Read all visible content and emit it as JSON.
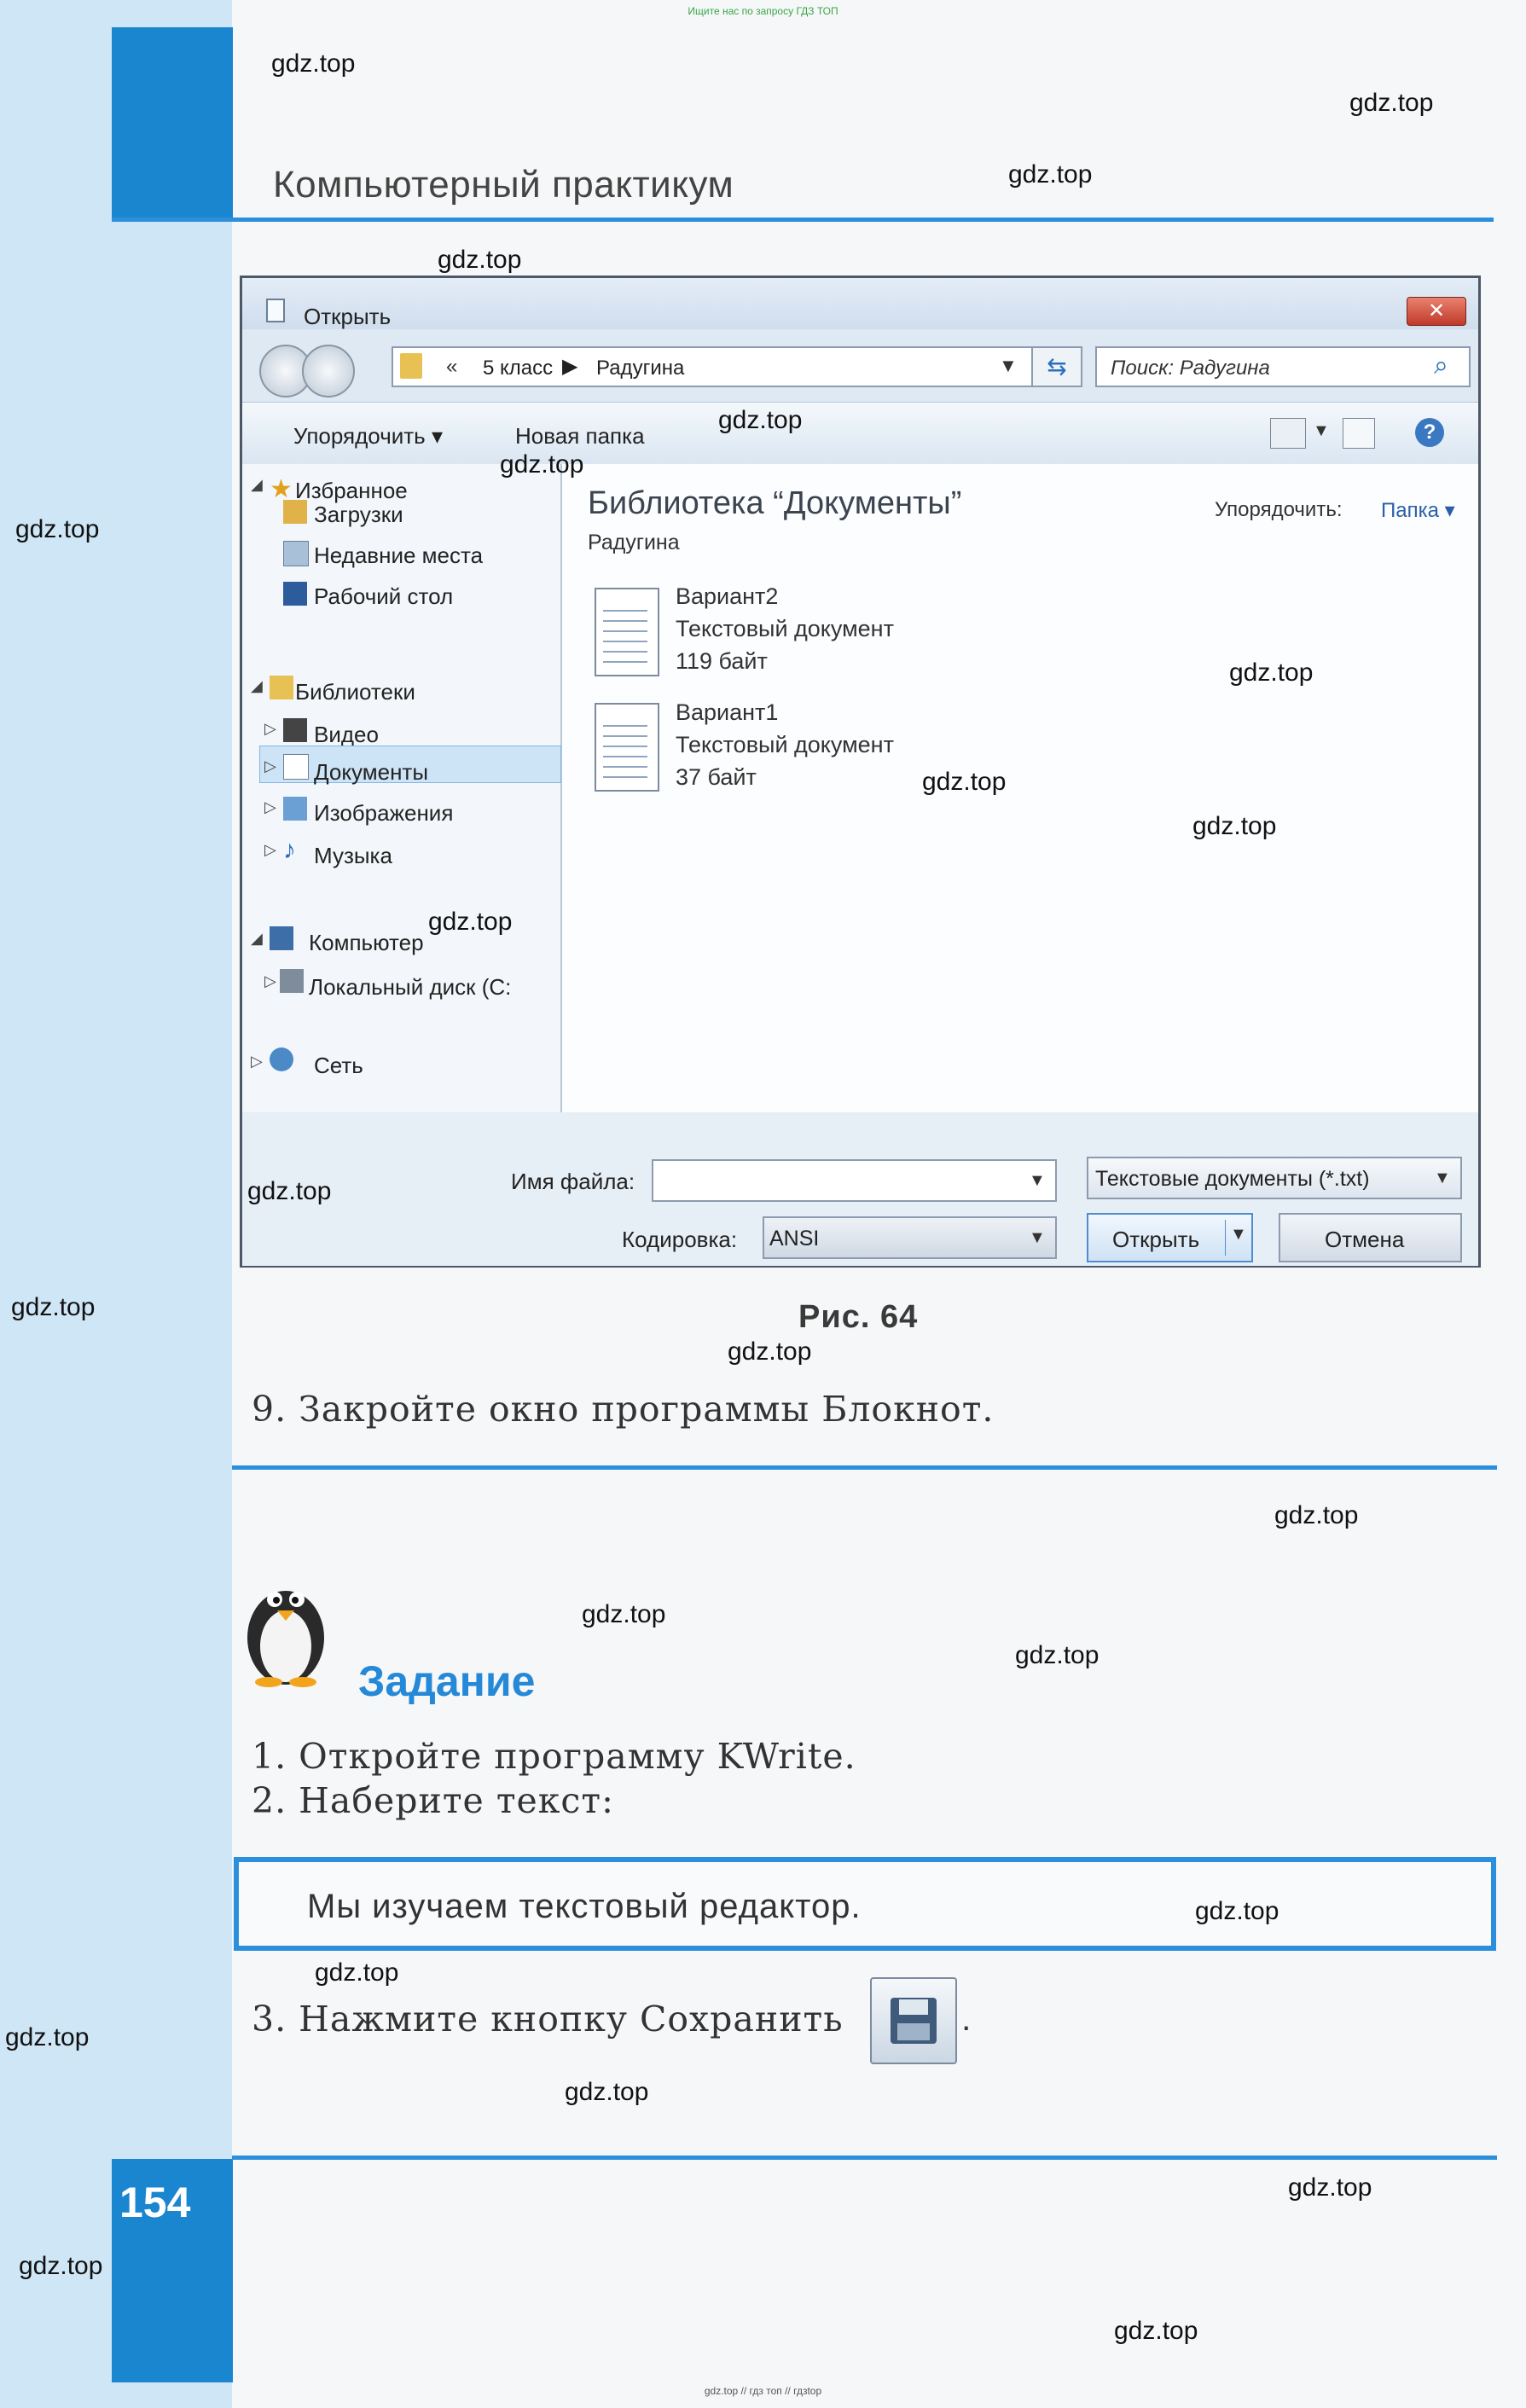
{
  "page": {
    "top_note": "Ищите нас по запросу ГДЗ ТОП",
    "bottom_note": "gdz.top // гдз топ // гдзtop",
    "header_title": "Компьютерный практикум",
    "page_number": "154",
    "watermark": "gdz.top"
  },
  "dialog": {
    "title": "Открыть",
    "close_label": "✕",
    "address": {
      "chevron": "«",
      "crumbs": [
        "5 класс",
        "Радугина"
      ],
      "separator": "▶"
    },
    "search_placeholder": "Поиск: Радугина",
    "toolbar": {
      "organize": "Упорядочить ▾",
      "new_folder": "Новая папка",
      "help": "?"
    },
    "nav": {
      "favorites": "Избранное",
      "downloads": "Загрузки",
      "recent": "Недавние места",
      "desktop": "Рабочий стол",
      "libraries": "Библиотеки",
      "video": "Видео",
      "documents": "Документы",
      "images": "Изображения",
      "music": "Музыка",
      "computer": "Компьютер",
      "local_disk": "Локальный диск (C:",
      "network": "Сеть"
    },
    "content": {
      "title": "Библиотека “Документы”",
      "subtitle": "Радугина",
      "arrange_label": "Упорядочить:",
      "arrange_value": "Папка ▾",
      "files": [
        {
          "name": "Вариант2",
          "type": "Текстовый документ",
          "size": "119 байт"
        },
        {
          "name": "Вариант1",
          "type": "Текстовый документ",
          "size": "37 байт"
        }
      ]
    },
    "bottom": {
      "filename_label": "Имя файла:",
      "filename_value": "",
      "filter": "Текстовые документы (*.txt)",
      "encoding_label": "Кодировка:",
      "encoding_value": "ANSI",
      "open": "Открыть",
      "cancel": "Отмена"
    }
  },
  "figure_caption": "Рис. 64",
  "step9": "9. Закройте окно программы Блокнот.",
  "task": {
    "title": "Задание",
    "item1": "1. Откройте программу KWrite.",
    "item2": "2. Наберите текст:",
    "text_box": "Мы изучаем текстовый редактор.",
    "item3": "3. Нажмите кнопку Сохранить",
    "item3_end": "."
  }
}
